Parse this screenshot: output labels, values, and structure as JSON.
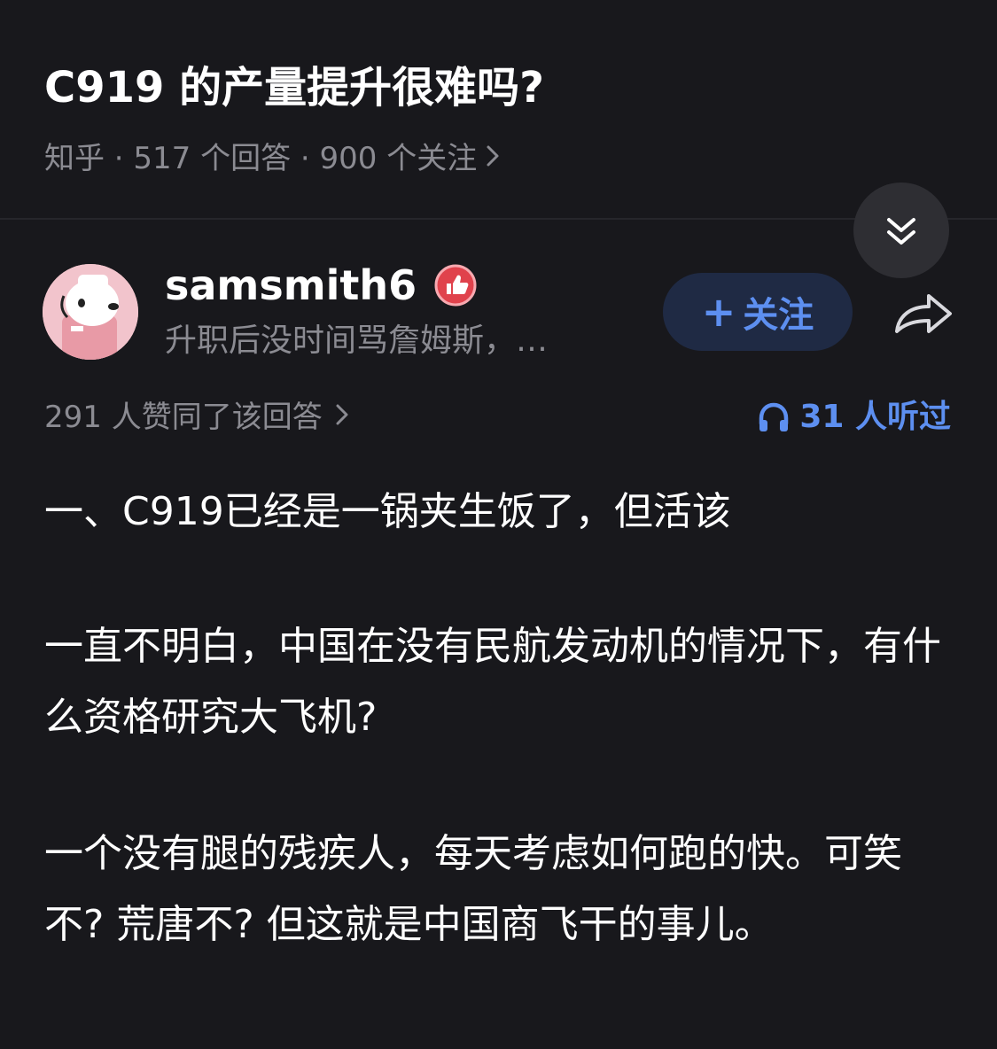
{
  "question": {
    "title": "C919 的产量提升很难吗?",
    "meta": "知乎 · 517 个回答 · 900 个关注"
  },
  "author": {
    "name": "samsmith6",
    "bio": "升职后没时间骂詹姆斯，…"
  },
  "actions": {
    "follow_plus": "+",
    "follow_label": "关注"
  },
  "stats": {
    "votes_text": "291 人赞同了该回答",
    "listen_text": "31 人听过"
  },
  "content": {
    "paragraphs": [
      "一、C919已经是一锅夹生饭了，但活该",
      "一直不明白，中国在没有民航发动机的情况下，有什么资格研究大飞机?",
      "一个没有腿的残疾人，每天考虑如何跑的快。可笑不? 荒唐不? 但这就是中国商飞干的事儿。"
    ]
  },
  "colors": {
    "background": "#18181c",
    "accent": "#5d8ff0",
    "secondary_text": "#8b8b92",
    "badge_red": "#e0424c"
  },
  "icons": {
    "collapse": "double-chevron-down-icon",
    "share": "share-arrow-icon",
    "listen": "headphones-icon",
    "badge": "thumbs-up-badge-icon"
  }
}
